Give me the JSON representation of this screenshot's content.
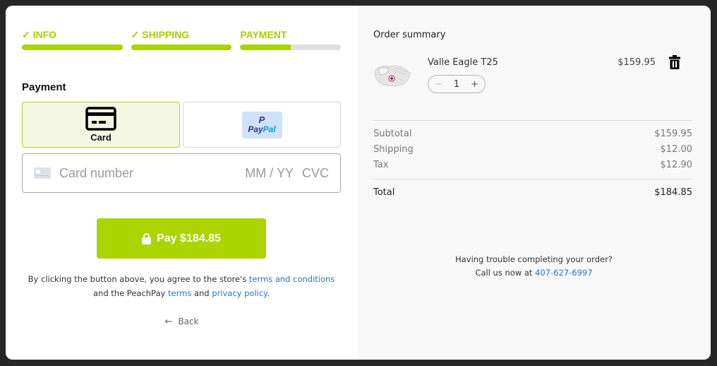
{
  "steps": [
    {
      "label": "✓ INFO",
      "progress": 1.0
    },
    {
      "label": "✓ SHIPPING",
      "progress": 1.0
    },
    {
      "label": "PAYMENT",
      "progress": 0.5
    }
  ],
  "colors": {
    "accent": "#abd400",
    "link": "#2a74c9",
    "paypal_dark": "#253b80",
    "paypal_light": "#179bd7"
  },
  "payment": {
    "title": "Payment",
    "methods": [
      {
        "label": "Card",
        "icon": "credit-card-icon",
        "selected": true
      },
      {
        "label": "PayPal",
        "icon": "paypal-logo",
        "selected": false
      }
    ],
    "paypal_logo": {
      "p": "P",
      "pay": "Pay",
      "pal": "Pal"
    },
    "card_input": {
      "number_placeholder": "Card number",
      "expiry_placeholder": "MM / YY",
      "cvc_placeholder": "CVC"
    },
    "pay_button_label": "Pay $184.85",
    "legal": {
      "prefix": "By clicking the button above, you agree to the store's ",
      "store_terms_link": "terms and conditions",
      "middle": " and the PeachPay ",
      "peachpay_terms_link": "terms",
      "and": " and ",
      "privacy_link": "privacy policy",
      "suffix": "."
    },
    "back_arrow": "←",
    "back_label": "Back"
  },
  "summary": {
    "title": "Order summary",
    "items": [
      {
        "name": "Valle Eagle T25",
        "quantity": "1",
        "price": "$159.95",
        "minus": "−",
        "plus": "+"
      }
    ],
    "subtotal": {
      "label": "Subtotal",
      "value": "$159.95"
    },
    "shipping": {
      "label": "Shipping",
      "value": "$12.00"
    },
    "tax": {
      "label": "Tax",
      "value": "$12.90"
    },
    "total": {
      "label": "Total",
      "value": "$184.85"
    },
    "help": {
      "line1": "Having trouble completing your order?",
      "line2": "Call us now at ",
      "phone": "407-627-6997"
    }
  }
}
